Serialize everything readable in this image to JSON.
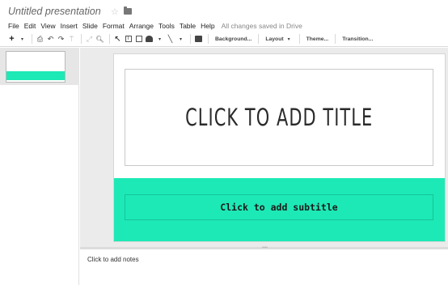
{
  "app": {
    "document_title": "Untitled presentation",
    "star_icon": "☆"
  },
  "menu": {
    "items": [
      "File",
      "Edit",
      "View",
      "Insert",
      "Slide",
      "Format",
      "Arrange",
      "Tools",
      "Table",
      "Help"
    ],
    "status": "All changes saved in Drive"
  },
  "toolbar": {
    "new_slide_icon": "+",
    "new_slide_dropdown_icon": "▾",
    "print_icon": "⎙",
    "undo_icon": "↶",
    "redo_icon": "↷",
    "paint_format_icon": "⍑",
    "fit_icon": "⤢",
    "zoom_icon": "🔍︎",
    "select_icon": "↖",
    "shape_dropdown_icon": "▾",
    "line_icon": "╲",
    "line_dropdown_icon": "▾",
    "background_label": "Background...",
    "layout_label": "Layout",
    "layout_dropdown_icon": "▾",
    "theme_label": "Theme...",
    "transition_label": "Transition..."
  },
  "slide": {
    "title_placeholder": "Click to add title",
    "subtitle_placeholder": "Click to add subtitle",
    "band_color": "#1de9b6"
  },
  "notes": {
    "placeholder": "Click to add notes"
  }
}
